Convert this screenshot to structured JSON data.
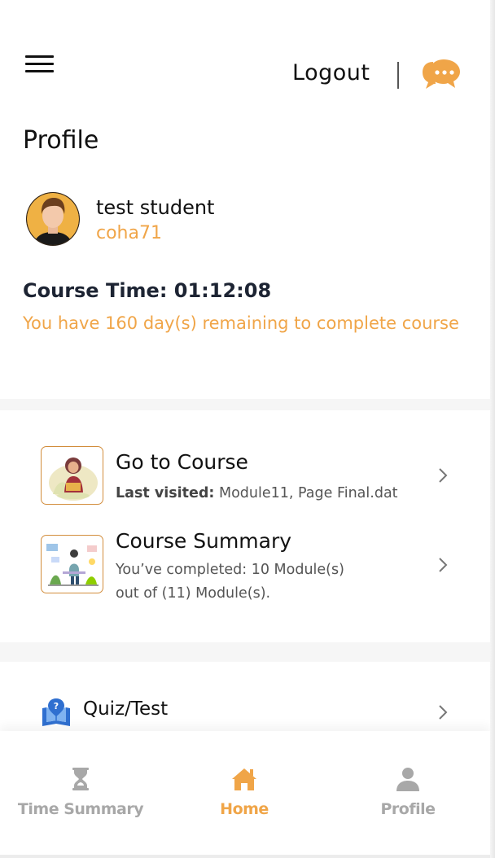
{
  "header": {
    "logout_label": "Logout",
    "menu_icon": "hamburger-menu-icon",
    "chat_icon": "chat-bubble-icon"
  },
  "page": {
    "title": "Profile"
  },
  "user": {
    "name": "test student",
    "username": "coha71"
  },
  "course": {
    "time_text": "Course Time: 01:12:08",
    "remaining_text": "You have 160 day(s) remaining to complete course"
  },
  "actions": {
    "go_to_course": {
      "title": "Go to Course",
      "last_visited_label": "Last visited:",
      "last_visited_value": " Module11, Page Final.dat"
    },
    "course_summary": {
      "title": "Course Summary",
      "line1": "You’ve completed: 10 Module(s)",
      "line2": "out of (11) Module(s)."
    },
    "quiz": {
      "title": "Quiz/Test"
    }
  },
  "tabbar": {
    "tabs": [
      {
        "label": "Time Summary",
        "icon": "hourglass-icon",
        "active": false
      },
      {
        "label": "Home",
        "icon": "home-icon",
        "active": true
      },
      {
        "label": "Profile",
        "icon": "person-icon",
        "active": false
      }
    ]
  },
  "colors": {
    "accent": "#f0a548",
    "inactive_tab": "#a8a8a8",
    "text_dark": "#111111"
  }
}
